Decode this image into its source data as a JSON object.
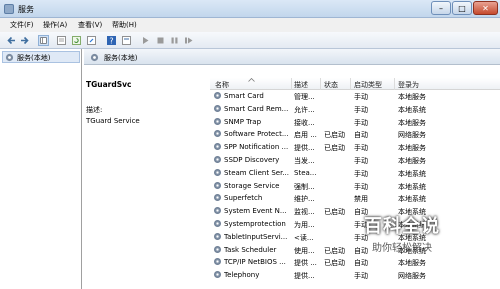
{
  "window": {
    "title": "服务",
    "btn_min": "–",
    "btn_max": "□",
    "btn_close": "✕"
  },
  "menu": [
    "文件(F)",
    "操作(A)",
    "查看(V)",
    "帮助(H)"
  ],
  "tree": {
    "item": "服务(本地)"
  },
  "pane": {
    "header": "服务(本地)",
    "service_name": "TGuardSvc",
    "desc_label": "描述:",
    "desc_value": "TGuard Service"
  },
  "columns": [
    "名称",
    "描述",
    "状态",
    "启动类型",
    "登录为"
  ],
  "rows": [
    {
      "name": "Smart Card",
      "desc": "管理...",
      "status": "",
      "startup": "手动",
      "logon": "本地服务"
    },
    {
      "name": "Smart Card Rem...",
      "desc": "允许...",
      "status": "",
      "startup": "手动",
      "logon": "本地系统"
    },
    {
      "name": "SNMP Trap",
      "desc": "接收...",
      "status": "",
      "startup": "手动",
      "logon": "本地服务"
    },
    {
      "name": "Software Protect...",
      "desc": "启用 ...",
      "status": "已启动",
      "startup": "自动",
      "logon": "网络服务"
    },
    {
      "name": "SPP Notification ...",
      "desc": "提供...",
      "status": "已启动",
      "startup": "手动",
      "logon": "本地服务"
    },
    {
      "name": "SSDP Discovery",
      "desc": "当发...",
      "status": "",
      "startup": "手动",
      "logon": "本地服务"
    },
    {
      "name": "Steam Client Ser...",
      "desc": "Stea...",
      "status": "",
      "startup": "手动",
      "logon": "本地系统"
    },
    {
      "name": "Storage Service",
      "desc": "强制...",
      "status": "",
      "startup": "手动",
      "logon": "本地系统"
    },
    {
      "name": "Superfetch",
      "desc": "维护...",
      "status": "",
      "startup": "禁用",
      "logon": "本地系统"
    },
    {
      "name": "System Event N...",
      "desc": "监视...",
      "status": "已启动",
      "startup": "自动",
      "logon": "本地系统"
    },
    {
      "name": "Systemprotection",
      "desc": "为用...",
      "status": "",
      "startup": "手动",
      "logon": "本地系统"
    },
    {
      "name": "TabletInputServi...",
      "desc": "<读...",
      "status": "",
      "startup": "手动",
      "logon": "本地系统"
    },
    {
      "name": "Task Scheduler",
      "desc": "使用...",
      "status": "已启动",
      "startup": "自动",
      "logon": "本地系统"
    },
    {
      "name": "TCP/IP NetBIOS ...",
      "desc": "提供 ...",
      "status": "已启动",
      "startup": "自动",
      "logon": "本地服务"
    },
    {
      "name": "Telephony",
      "desc": "提供...",
      "status": "",
      "startup": "手动",
      "logon": "网络服务"
    }
  ],
  "watermark": {
    "title": "百科全说",
    "subtitle": "助你轻松解决"
  }
}
